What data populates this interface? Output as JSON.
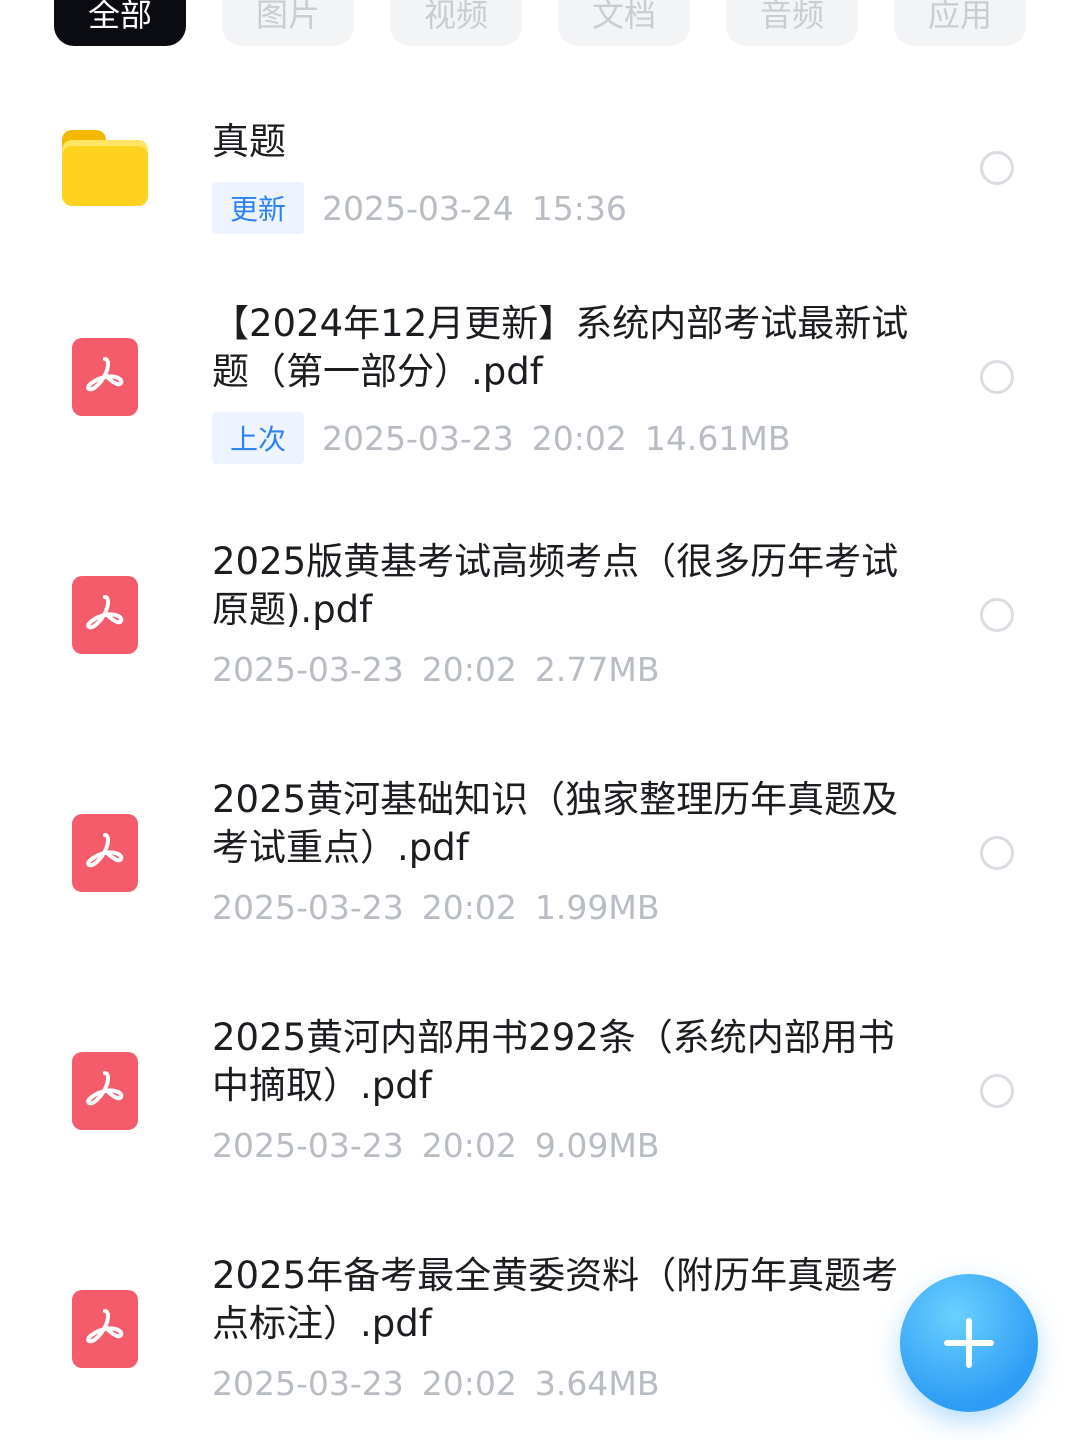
{
  "tabs": [
    {
      "label": "全部",
      "active": true
    },
    {
      "label": "图片",
      "active": false
    },
    {
      "label": "视频",
      "active": false
    },
    {
      "label": "文档",
      "active": false
    },
    {
      "label": "音频",
      "active": false
    },
    {
      "label": "应用",
      "active": false
    }
  ],
  "files": [
    {
      "type": "folder",
      "icon": "folder-icon",
      "title": "真题",
      "badge": "更新",
      "date": "2025-03-24",
      "time": "15:36",
      "size": ""
    },
    {
      "type": "pdf",
      "icon": "pdf-icon",
      "title": "【2024年12月更新】系统内部考试最新试题（第一部分）.pdf",
      "badge": "上次",
      "date": "2025-03-23",
      "time": "20:02",
      "size": "14.61MB"
    },
    {
      "type": "pdf",
      "icon": "pdf-icon",
      "title": "2025版黄基考试高频考点（很多历年考试原题).pdf",
      "badge": "",
      "date": "2025-03-23",
      "time": "20:02",
      "size": "2.77MB"
    },
    {
      "type": "pdf",
      "icon": "pdf-icon",
      "title": "2025黄河基础知识（独家整理历年真题及考试重点）.pdf",
      "badge": "",
      "date": "2025-03-23",
      "time": "20:02",
      "size": "1.99MB"
    },
    {
      "type": "pdf",
      "icon": "pdf-icon",
      "title": "2025黄河内部用书292条（系统内部用书中摘取）.pdf",
      "badge": "",
      "date": "2025-03-23",
      "time": "20:02",
      "size": "9.09MB"
    },
    {
      "type": "pdf",
      "icon": "pdf-icon",
      "title": "2025年备考最全黄委资料（附历年真题考点标注）.pdf",
      "badge": "",
      "date": "2025-03-23",
      "time": "20:02",
      "size": "3.64MB"
    }
  ],
  "fab": {
    "icon": "plus-icon"
  },
  "colors": {
    "accent": "#2e82f5",
    "pdf": "#f45c6c",
    "folder": "#ffd21f"
  }
}
